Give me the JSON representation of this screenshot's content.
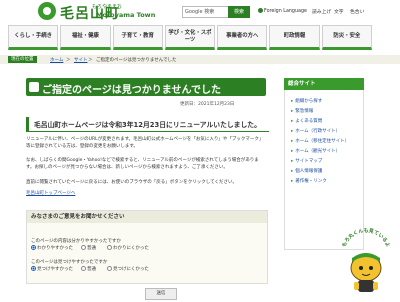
{
  "header": {
    "logo_text": "毛呂山町",
    "logo_kana": "もろやままち",
    "logo_roman": "Moroyama Town",
    "search_placeholder": "Google 検索",
    "search_button": "検索",
    "util_links": [
      "Foreign Language",
      "読み上げ",
      "文字",
      "色合い"
    ]
  },
  "nav": [
    "くらし・手続き",
    "福祉・健康",
    "子育て・教育",
    "学び・文化・スポーツ",
    "事業者の方へ",
    "町政情報",
    "防災・安全"
  ],
  "breadcrumb": {
    "label": "現在の位置",
    "items": [
      "ホーム",
      "サイト",
      "ご指定のページは見つかりませんでした"
    ]
  },
  "main": {
    "title": "ご指定のページは見つかりませんでした",
    "updated": "更新日：2021年12月23日",
    "renewal_heading": "毛呂山町ホームページは令和3年12月23日にリニューアルいたしました。",
    "para1": "リニューアルに伴い、ページのURLが変更されます。毛呂山町公式ホームページを「お気に入り」や「ブックマーク」等に登録されている方は、登録の変更をお願いします。",
    "para2": "なお、しばらくの間Google・Yahoo!などで検索すると、リニューアル前のページが検索されてしまう場合があります。お探しのページが見つからない場合は、新しいページから検索されますよう、ご了承ください。",
    "para3": "直前に閲覧されていたページに戻るには、お使いのブラウザの「戻る」ボタンをクリックしてください。",
    "top_link": "毛呂山町トップページへ"
  },
  "survey": {
    "title": "みなさまのご意見をお聞かせください",
    "q1": "このページの内容は分かりやすかったですか",
    "q1_options": [
      "わかりやすかった",
      "普通",
      "わかりにくかった"
    ],
    "q2": "このページは見つけやすかったですか",
    "q2_options": [
      "見つけやすかった",
      "普通",
      "見つけにくかった"
    ],
    "submit": "送信"
  },
  "sidebar": {
    "title": "総合サイト",
    "items": [
      "組織から探す",
      "緊急情報",
      "よくある質問",
      "ホーム（行政サイト）",
      "ホーム（移住定住サイト）",
      "ホーム（観光サイト）",
      "サイトマップ",
      "個人情報保護",
      "著作権・リンク"
    ]
  },
  "mascot": {
    "caption": "もろ丸くんも見ているよ"
  },
  "colors": {
    "brand_green": "#2d7f24",
    "accent_green": "#3a9a2d",
    "link_blue": "#1a4da1"
  }
}
